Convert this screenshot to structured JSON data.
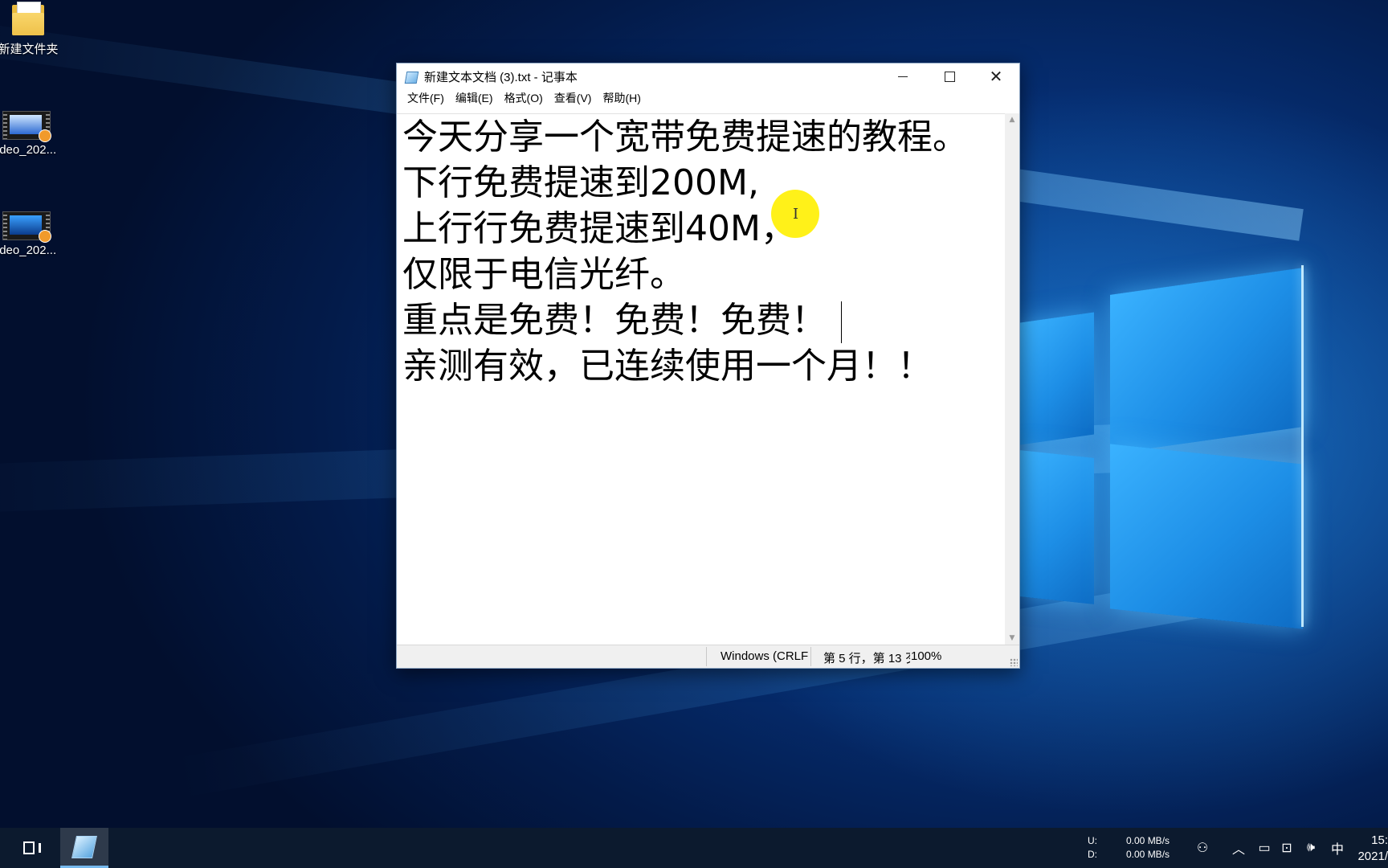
{
  "desktop": {
    "icons": [
      {
        "label": "新建文件夹",
        "icon": "folder-icon"
      },
      {
        "label": "ideo_202...",
        "icon": "video-file-icon"
      },
      {
        "label": "ideo_202...",
        "icon": "video-file-icon"
      }
    ]
  },
  "notepad": {
    "title": "新建文本文档 (3).txt - 记事本",
    "menu": [
      "文件(F)",
      "编辑(E)",
      "格式(O)",
      "查看(V)",
      "帮助(H)"
    ],
    "lines": [
      "今天分享一个宽带免费提速的教程。",
      "下行免费提速到200M,",
      "上行行免费提速到40M，",
      "仅限于电信光纤。",
      "重点是免费！免费！免费！",
      "亲测有效，已连续使用一个月！！"
    ],
    "status": {
      "line_ending": "Windows (CRLF",
      "position": "第 5 行，第 13 歹",
      "zoom": "100%"
    }
  },
  "taskbar": {
    "netspeed_labels": [
      "U:",
      "D:"
    ],
    "netspeed_values": [
      "0.00 MB/s",
      "0.00 MB/s"
    ],
    "ime": "中",
    "clock_time": "15:",
    "clock_date": "2021/"
  }
}
